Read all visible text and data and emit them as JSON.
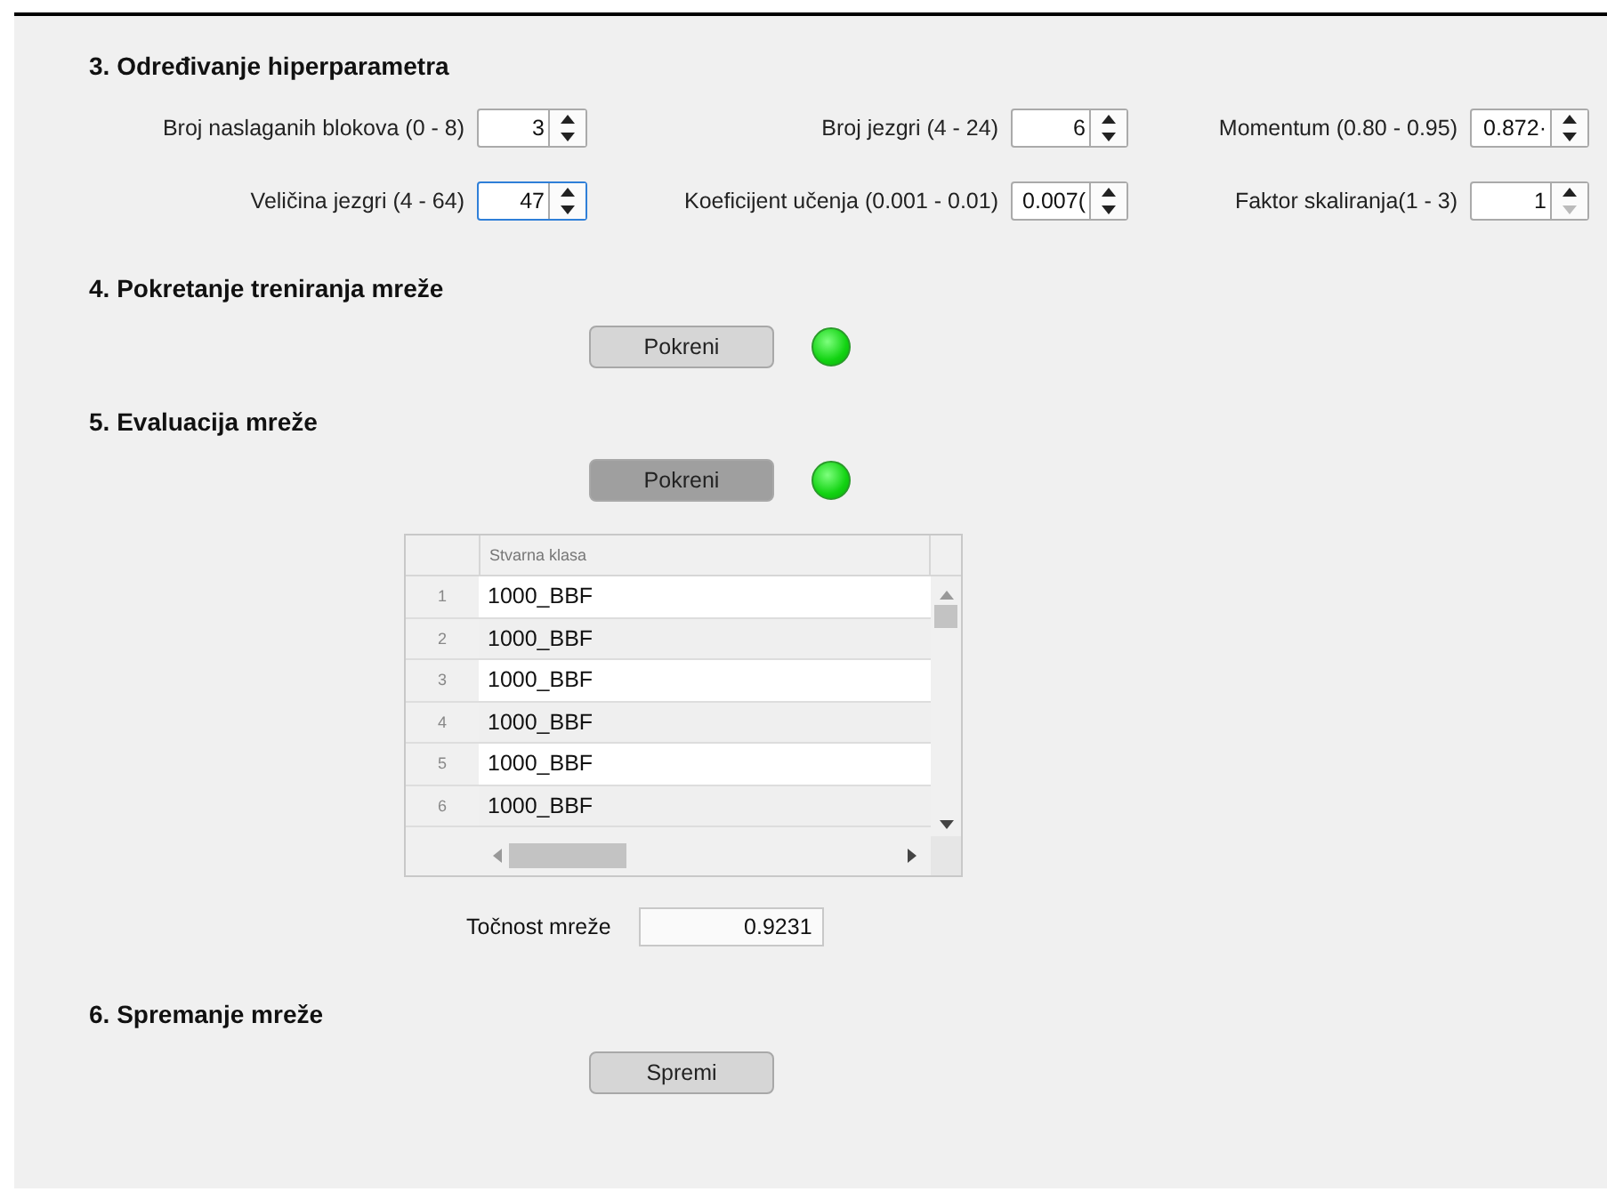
{
  "sections": [
    {
      "title": "3. Određivanje hiperparametra",
      "kind": "params"
    },
    {
      "title": "4. Pokretanje treniranja mreže",
      "kind": "action"
    },
    {
      "title": "5. Evaluacija mreže",
      "kind": "evaluation"
    },
    {
      "title": "6. Spremanje mreže",
      "kind": "save"
    }
  ],
  "parameters": [
    {
      "label": "Broj naslaganih blokova (0 - 8)",
      "value": "3",
      "focused": false,
      "decrement_disabled": false
    },
    {
      "label": "Broj jezgri (4 - 24)",
      "value": "6",
      "focused": false,
      "decrement_disabled": false
    },
    {
      "label": "Momentum (0.80 - 0.95)",
      "value": "0.872·",
      "focused": false,
      "decrement_disabled": false
    },
    {
      "label": "Veličina jezgri (4 - 64)",
      "value": "47",
      "focused": true,
      "decrement_disabled": false
    },
    {
      "label": "Koeficijent učenja (0.001 - 0.01)",
      "value": "0.007(",
      "focused": false,
      "decrement_disabled": false
    },
    {
      "label": "Faktor skaliranja(1 - 3)",
      "value": "1",
      "focused": false,
      "decrement_disabled": true
    }
  ],
  "training": {
    "button": "Pokreni",
    "pressed": false,
    "lamp_lit": true
  },
  "evaluation": {
    "button": "Pokreni",
    "pressed": true,
    "lamp_lit": true,
    "table": {
      "columns": [
        "Stvarna klasa"
      ],
      "rows": [
        {
          "number": "1",
          "value": "1000_BBF"
        },
        {
          "number": "2",
          "value": "1000_BBF"
        },
        {
          "number": "3",
          "value": "1000_BBF"
        },
        {
          "number": "4",
          "value": "1000_BBF"
        },
        {
          "number": "5",
          "value": "1000_BBF"
        },
        {
          "number": "6",
          "value": "1000_BBF"
        }
      ]
    },
    "accuracy_label": "Točnost mreže",
    "accuracy_value": "0.9231"
  },
  "save": {
    "button": "Spremi",
    "pressed": false
  }
}
